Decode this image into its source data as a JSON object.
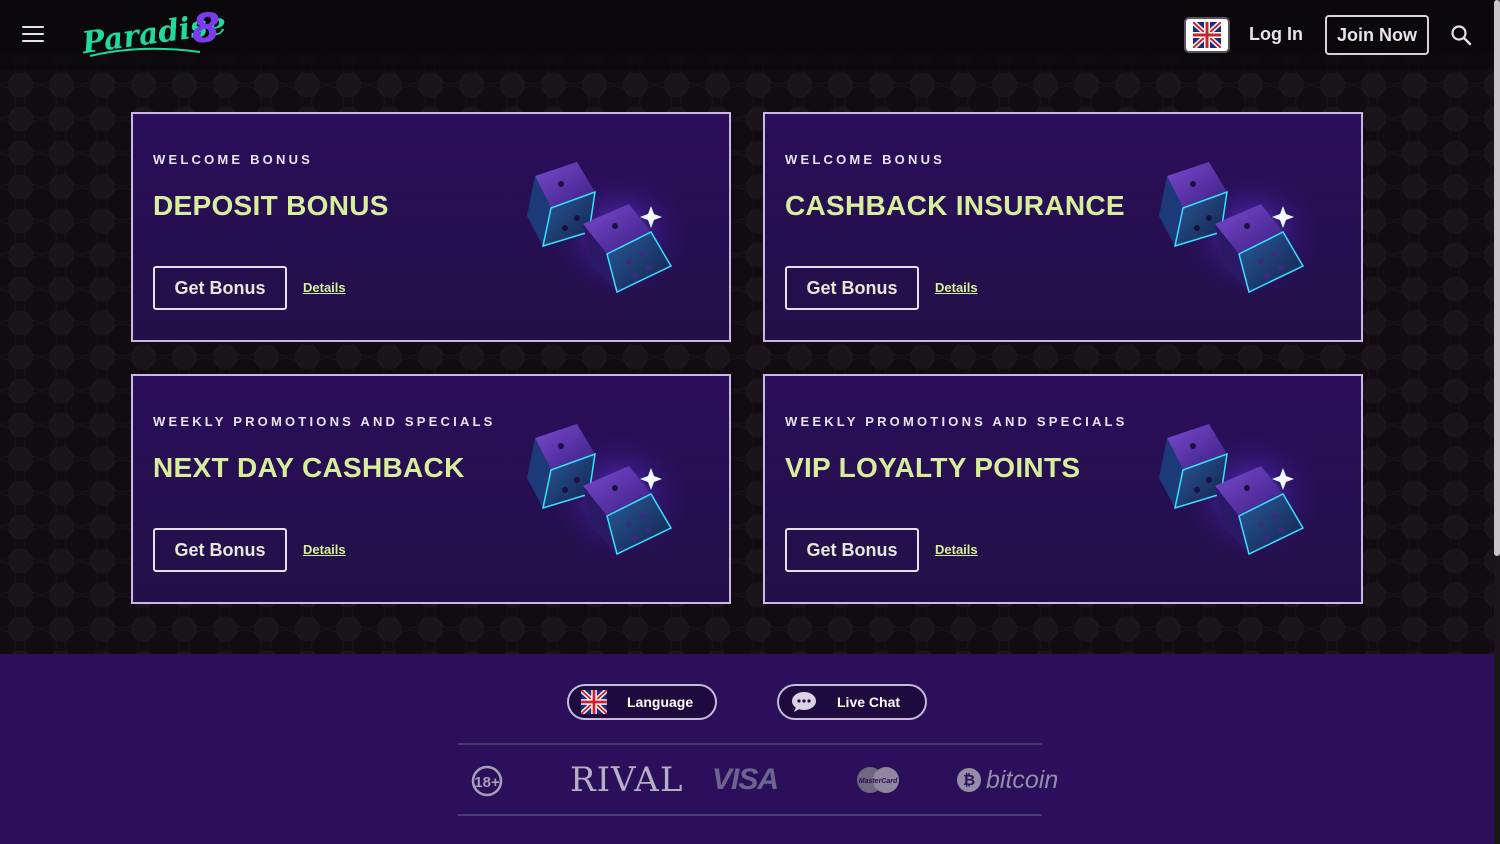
{
  "header": {
    "logo_text": "Paradise8",
    "login_label": "Log In",
    "join_label": "Join Now"
  },
  "cards": [
    {
      "category": "WELCOME BONUS",
      "title": "DEPOSIT BONUS",
      "button": "Get Bonus",
      "details": "Details"
    },
    {
      "category": "WELCOME BONUS",
      "title": "CASHBACK INSURANCE",
      "button": "Get Bonus",
      "details": "Details"
    },
    {
      "category": "WEEKLY PROMOTIONS AND SPECIALS",
      "title": "NEXT DAY CASHBACK",
      "button": "Get Bonus",
      "details": "Details"
    },
    {
      "category": "WEEKLY PROMOTIONS AND SPECIALS",
      "title": "VIP LOYALTY POINTS",
      "button": "Get Bonus",
      "details": "Details"
    }
  ],
  "footer": {
    "language_label": "Language",
    "chat_label": "Live Chat",
    "age_label": "18+",
    "provider": "RIVAL",
    "payments": [
      "VISA",
      "MasterCard",
      "bitcoin"
    ]
  },
  "colors": {
    "accent": "#d7ef9b",
    "card_bg": "#2a0e5a",
    "footer_bg": "#2b0f5a",
    "logo_green": "#1fd9a0",
    "logo_purple": "#7b3cf0"
  }
}
